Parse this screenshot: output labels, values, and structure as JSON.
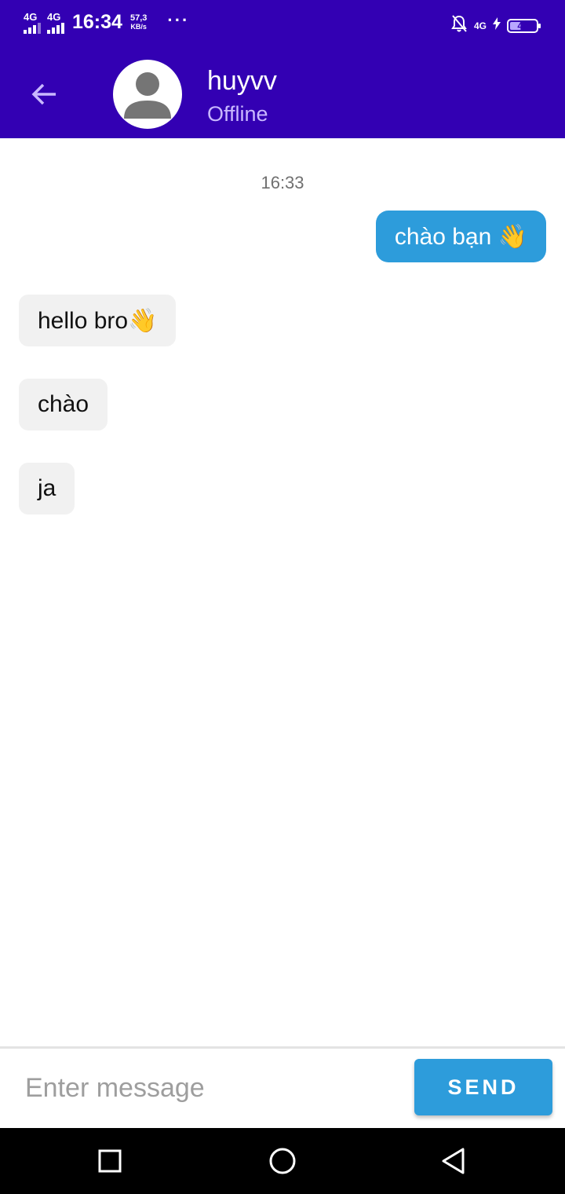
{
  "status_bar": {
    "sim1_label": "4G",
    "sim2_label": "4G",
    "time": "16:34",
    "speed_value": "57,3",
    "speed_unit": "KB/s",
    "more_dots": "···",
    "network_label": "4G",
    "battery_level": 40,
    "battery_text": "40",
    "icons": [
      "signal-icon",
      "signal-icon",
      "notifications-off-icon",
      "charging-icon",
      "battery-icon"
    ]
  },
  "header": {
    "contact_name": "huyvv",
    "contact_status": "Offline",
    "icons": [
      "back-arrow-icon",
      "avatar-person-icon"
    ]
  },
  "chat": {
    "timestamp": "16:33",
    "messages": [
      {
        "direction": "sent",
        "text": "chào bạn 👋"
      },
      {
        "direction": "received",
        "text": "hello bro👋"
      },
      {
        "direction": "received",
        "text": "chào"
      },
      {
        "direction": "received",
        "text": "ja"
      }
    ]
  },
  "composer": {
    "placeholder": "Enter message",
    "value": "",
    "send_label": "SEND"
  },
  "nav_bar": {
    "icons": [
      "recents-square-icon",
      "home-circle-icon",
      "back-triangle-icon"
    ]
  },
  "colors": {
    "header_bg": "#3300b3",
    "sent_bubble": "#2d9cdb",
    "received_bubble": "#f1f1f1",
    "send_button": "#2d9cdb",
    "status_text": "#c9b8ff"
  }
}
